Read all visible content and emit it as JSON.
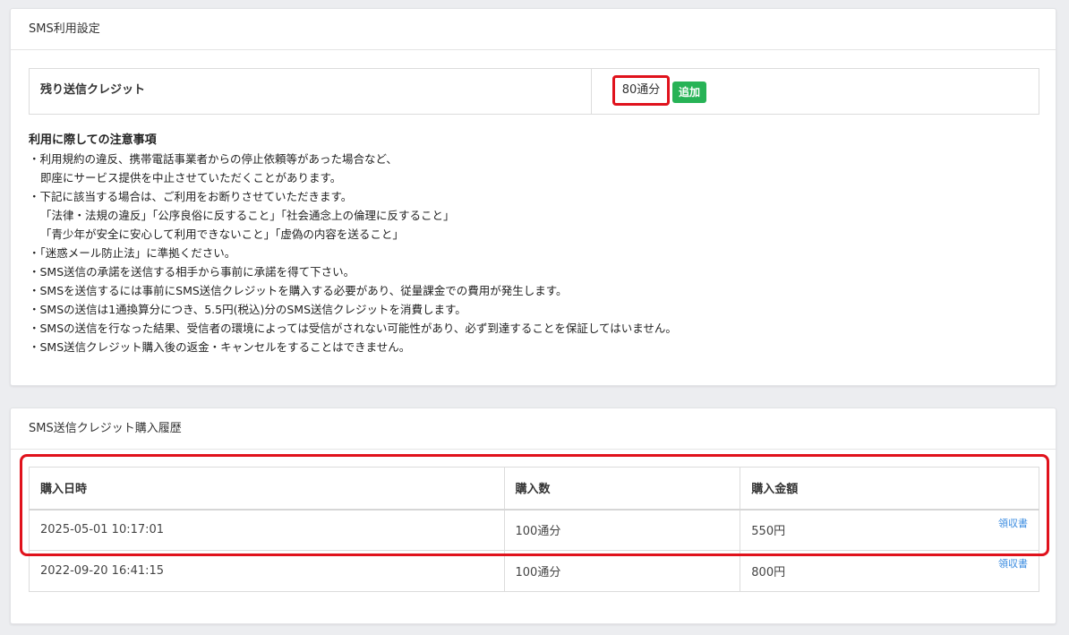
{
  "settings_card": {
    "title": "SMS利用設定",
    "credit": {
      "label": "残り送信クレジット",
      "value": "80通分",
      "add_label": "追加"
    },
    "notes": {
      "title": "利用に際しての注意事項",
      "lines": [
        "・利用規約の違反、携帯電話事業者からの停止依頼等があった場合など、",
        "即座にサービス提供を中止させていただくことがあります。",
        "・下記に該当する場合は、ご利用をお断りさせていただきます。",
        "「法律・法規の違反」「公序良俗に反すること」「社会通念上の倫理に反すること」",
        "「青少年が安全に安心して利用できないこと」「虚偽の内容を送ること」",
        "・「迷惑メール防止法」に準拠ください。",
        "・SMS送信の承諾を送信する相手から事前に承諾を得て下さい。",
        "・SMSを送信するには事前にSMS送信クレジットを購入する必要があり、従量課金での費用が発生します。",
        "・SMSの送信は1通換算分につき、5.5円(税込)分のSMS送信クレジットを消費します。",
        "・SMSの送信を行なった結果、受信者の環境によっては受信がされない可能性があり、必ず到達することを保証してはいません。",
        "・SMS送信クレジット購入後の返金・キャンセルをすることはできません。"
      ]
    }
  },
  "history_card": {
    "title": "SMS送信クレジット購入履歴",
    "columns": [
      "購入日時",
      "購入数",
      "購入金額"
    ],
    "receipt_label": "領収書",
    "rows": [
      {
        "date": "2025-05-01 10:17:01",
        "count": "100通分",
        "amount": "550円"
      },
      {
        "date": "2022-09-20 16:41:15",
        "count": "100通分",
        "amount": "800円"
      }
    ]
  },
  "colors": {
    "accent_green": "#27b356",
    "highlight_red": "#e0121c",
    "link_blue": "#3a8be0"
  }
}
